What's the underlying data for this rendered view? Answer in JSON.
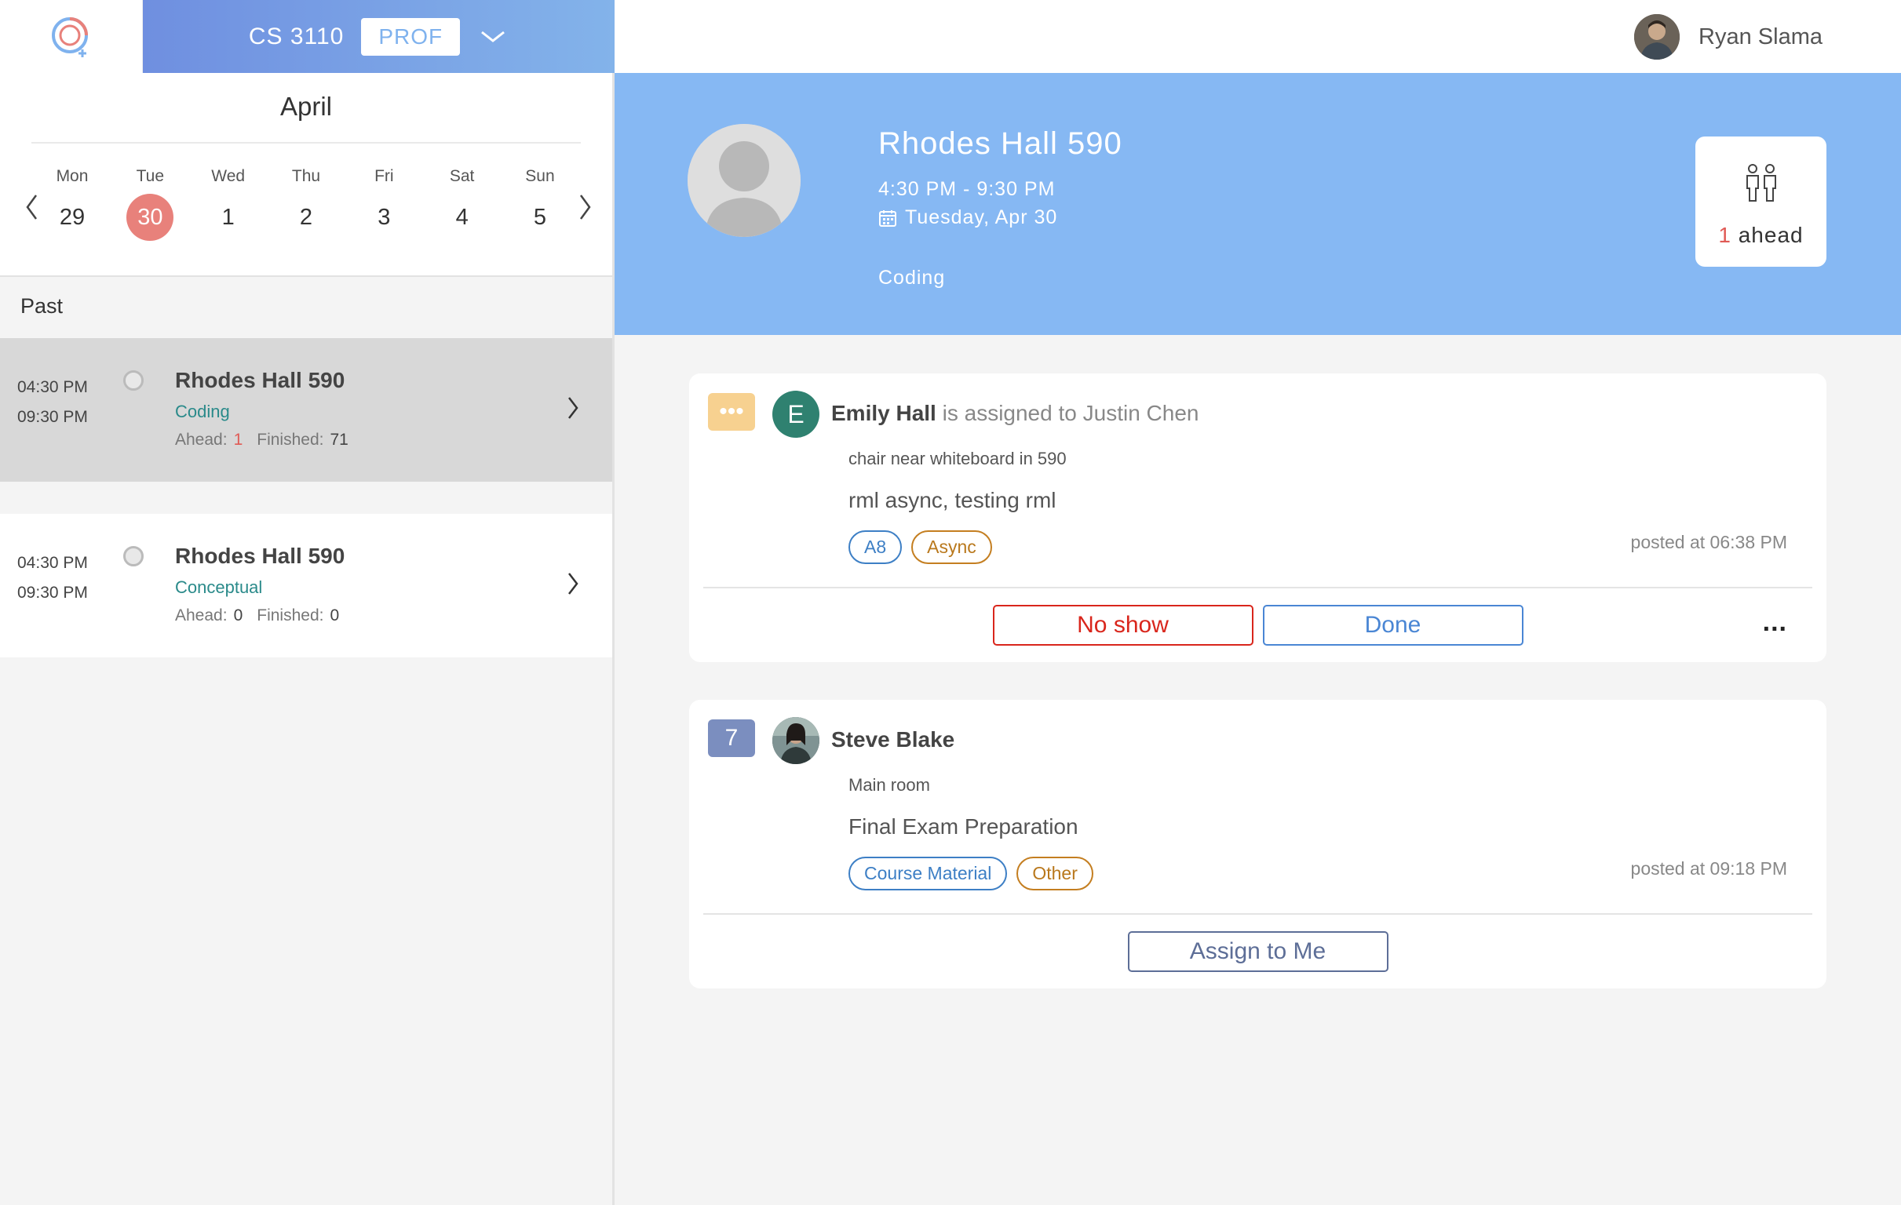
{
  "course": {
    "name": "CS 3110",
    "role": "PROF"
  },
  "user": {
    "name": "Ryan Slama"
  },
  "calendar": {
    "month": "April",
    "days": [
      {
        "dow": "Mon",
        "num": "29"
      },
      {
        "dow": "Tue",
        "num": "30"
      },
      {
        "dow": "Wed",
        "num": "1"
      },
      {
        "dow": "Thu",
        "num": "2"
      },
      {
        "dow": "Fri",
        "num": "3"
      },
      {
        "dow": "Sat",
        "num": "4"
      },
      {
        "dow": "Sun",
        "num": "5"
      }
    ],
    "selected_index": 1,
    "prev_icon": "chevron-left-icon",
    "next_icon": "chevron-right-icon"
  },
  "sessions_section": {
    "label": "Past"
  },
  "sessions": [
    {
      "start": "04:30 PM",
      "end": "09:30 PM",
      "title": "Rhodes Hall 590",
      "topic": "Coding",
      "ahead_label": "Ahead:",
      "ahead": "1",
      "finished_label": "Finished:",
      "finished": "71"
    },
    {
      "start": "04:30 PM",
      "end": "09:30 PM",
      "title": "Rhodes Hall 590",
      "topic": "Conceptual",
      "ahead_label": "Ahead:",
      "ahead": "0",
      "finished_label": "Finished:",
      "finished": "0"
    }
  ],
  "hero": {
    "title": "Rhodes Hall 590",
    "time": "4:30 PM - 9:30 PM",
    "date": "Tuesday, Apr 30",
    "topic": "Coding",
    "ahead_count": "1",
    "ahead_label": "ahead"
  },
  "questions": [
    {
      "badge": "•••",
      "avatar_letter": "E",
      "name": "Emily Hall",
      "assignment": " is assigned to Justin Chen",
      "location": "chair near whiteboard in 590",
      "content": "rml async, testing rml",
      "tags": [
        "A8",
        "Async"
      ],
      "posted": "posted at 06:38 PM",
      "actions": {
        "no_show": "No show",
        "done": "Done",
        "more": "..."
      }
    },
    {
      "badge": "7",
      "name": "Steve Blake",
      "location": "Main room",
      "content": "Final Exam Preparation",
      "tags": [
        "Course Material",
        "Other"
      ],
      "posted": "posted at 09:18 PM",
      "actions": {
        "assign": "Assign to Me"
      }
    }
  ],
  "colors": {
    "accent_blue": "#86b8f3",
    "selected_day": "#e8817b",
    "pending_badge": "#f7d190",
    "number_badge": "#7b8ebf",
    "no_show": "#d9261c",
    "done": "#4a86d4"
  }
}
